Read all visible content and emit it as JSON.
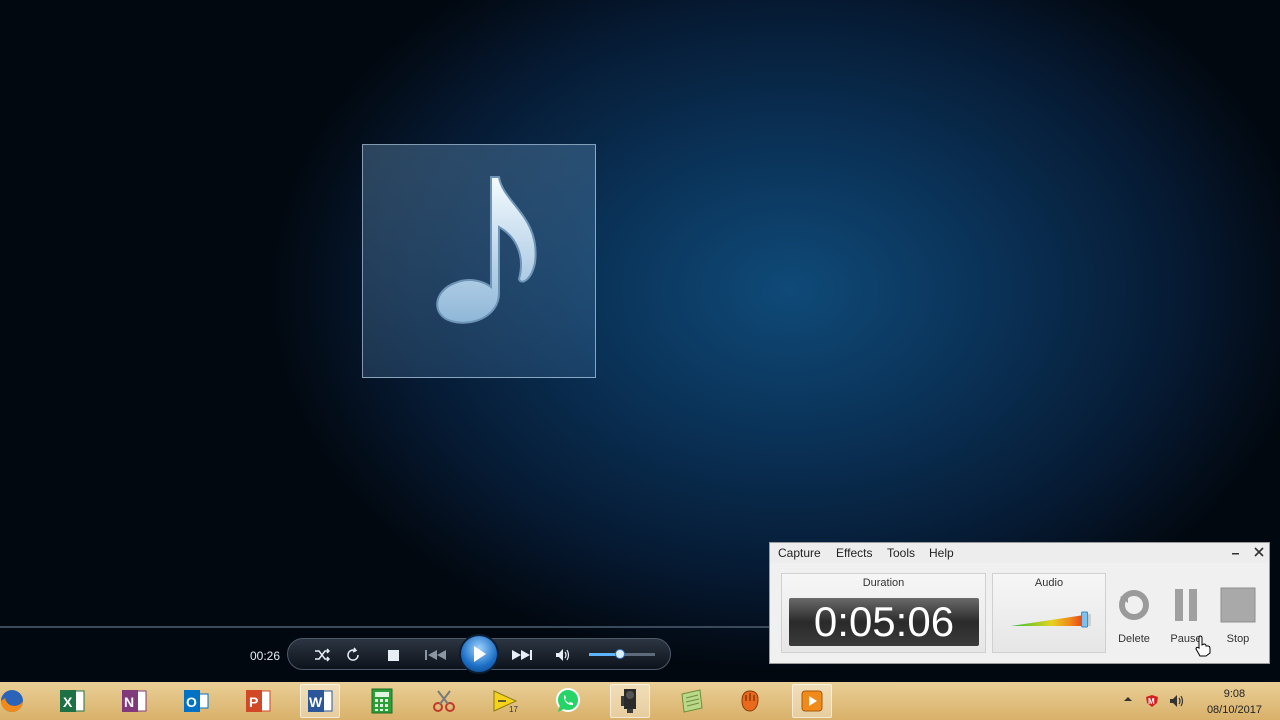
{
  "player": {
    "elapsed": "00:26",
    "volume_fraction": 0.47,
    "icons": [
      "music-note-icon",
      "shuffle-icon",
      "repeat-icon",
      "stop-icon",
      "previous-icon",
      "play-icon",
      "next-icon",
      "speaker-icon"
    ]
  },
  "recorder": {
    "menu": [
      "Capture",
      "Effects",
      "Tools",
      "Help"
    ],
    "duration_label": "Duration",
    "duration_value": "0:05:06",
    "audio_label": "Audio",
    "audio_level_fraction": 0.92,
    "buttons": {
      "delete": "Delete",
      "pause": "Pause",
      "stop": "Stop"
    }
  },
  "taskbar": {
    "apps": [
      "firefox",
      "excel",
      "onenote",
      "outlook",
      "powerpoint",
      "word",
      "calculator",
      "snipping-tool",
      "labview",
      "whatsapp",
      "camtasia-recorder",
      "notepad",
      "vlc",
      "media-player"
    ],
    "active_app": "camtasia-recorder",
    "clock_time": "9:08",
    "clock_date": "08/10/2017"
  },
  "colors": {
    "accent": "#1c6fc6",
    "excel": "#1e7145",
    "onenote": "#80397b",
    "outlook": "#0072c6",
    "powerpoint": "#d24726",
    "word": "#2b579a",
    "whatsapp": "#25d366"
  }
}
